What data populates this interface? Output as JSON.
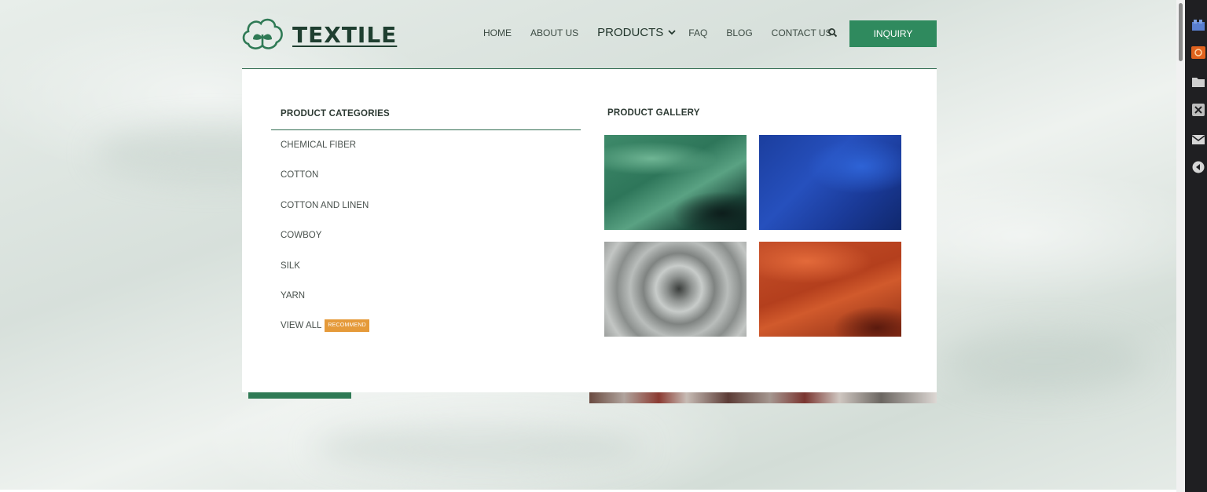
{
  "header": {
    "logo_text": "TEXTILE",
    "nav": [
      {
        "label": "HOME"
      },
      {
        "label": "ABOUT US"
      },
      {
        "label": "PRODUCTS",
        "active": true
      },
      {
        "label": "FAQ"
      },
      {
        "label": "BLOG"
      },
      {
        "label": "CONTACT US"
      }
    ],
    "search_icon": "search-icon",
    "inquiry_label": "INQUIRY"
  },
  "mega_menu": {
    "categories_title": "PRODUCT CATEGORIES",
    "categories": [
      {
        "label": "CHEMICAL FIBER"
      },
      {
        "label": "COTTON"
      },
      {
        "label": "COTTON AND LINEN"
      },
      {
        "label": "COWBOY"
      },
      {
        "label": "SILK"
      },
      {
        "label": "YARN"
      },
      {
        "label": "VIEW ALL",
        "badge": "RECOMMEND"
      }
    ],
    "gallery_title": "PRODUCT GALLERY",
    "gallery": [
      {
        "name": "green-fabric-image",
        "color": "#2e765a"
      },
      {
        "name": "blue-fabric-image",
        "color": "#2650bd"
      },
      {
        "name": "gray-fabric-image",
        "color": "#8e9290"
      },
      {
        "name": "orange-fabric-image",
        "color": "#b43f1d"
      }
    ]
  },
  "colors": {
    "accent": "#2f8a5e",
    "badge": "#e59a3a",
    "text_dark": "#2d3a33"
  },
  "browser_sidebar_icons": [
    "extension-icon",
    "orange-app-icon",
    "folder-icon",
    "close-box-icon",
    "mail-icon",
    "play-icon"
  ]
}
